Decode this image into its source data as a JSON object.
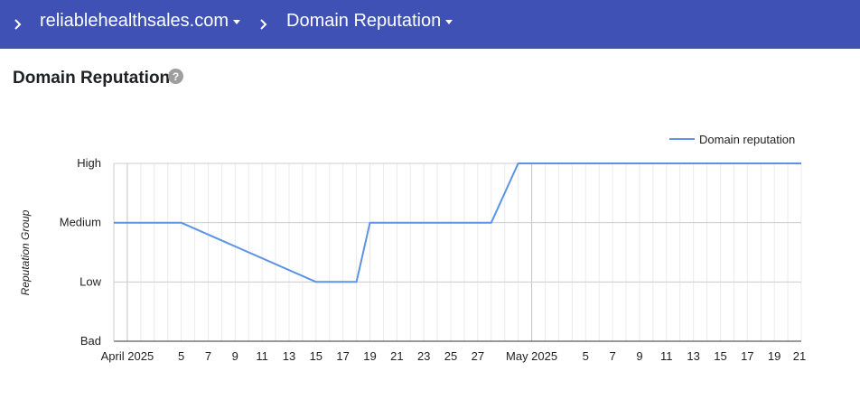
{
  "breadcrumb": {
    "domain": "reliablehealthsales.com",
    "section": "Domain Reputation"
  },
  "page": {
    "title": "Domain Reputation",
    "help_icon": "help-circle-icon"
  },
  "colors": {
    "topbar": "#3f51b5",
    "series": "#5c93e6",
    "grid": "#cccccc",
    "minor_grid": "#ebebeb"
  },
  "chart_data": {
    "type": "line",
    "ylabel": "Reputation Group",
    "xlabel": "",
    "y_categories": [
      "Bad",
      "Low",
      "Medium",
      "High"
    ],
    "x_range": [
      "2025-03-31",
      "2025-05-21"
    ],
    "x_ticks": [
      {
        "date": "2025-04-01",
        "label": "April 2025",
        "major": true
      },
      {
        "date": "2025-04-05",
        "label": "5"
      },
      {
        "date": "2025-04-07",
        "label": "7"
      },
      {
        "date": "2025-04-09",
        "label": "9"
      },
      {
        "date": "2025-04-11",
        "label": "11"
      },
      {
        "date": "2025-04-13",
        "label": "13"
      },
      {
        "date": "2025-04-15",
        "label": "15"
      },
      {
        "date": "2025-04-17",
        "label": "17"
      },
      {
        "date": "2025-04-19",
        "label": "19"
      },
      {
        "date": "2025-04-21",
        "label": "21"
      },
      {
        "date": "2025-04-23",
        "label": "23"
      },
      {
        "date": "2025-04-25",
        "label": "25"
      },
      {
        "date": "2025-04-27",
        "label": "27"
      },
      {
        "date": "2025-05-01",
        "label": "May 2025",
        "major": true
      },
      {
        "date": "2025-05-05",
        "label": "5"
      },
      {
        "date": "2025-05-07",
        "label": "7"
      },
      {
        "date": "2025-05-09",
        "label": "9"
      },
      {
        "date": "2025-05-11",
        "label": "11"
      },
      {
        "date": "2025-05-13",
        "label": "13"
      },
      {
        "date": "2025-05-15",
        "label": "15"
      },
      {
        "date": "2025-05-17",
        "label": "17"
      },
      {
        "date": "2025-05-19",
        "label": "19"
      },
      {
        "date": "2025-05-21",
        "label": "21"
      }
    ],
    "grid": true,
    "legend_position": "top-right",
    "series": [
      {
        "name": "Domain reputation",
        "points": [
          {
            "x": "2025-03-31",
            "y": "Medium"
          },
          {
            "x": "2025-04-05",
            "y": "Medium"
          },
          {
            "x": "2025-04-15",
            "y": "Low"
          },
          {
            "x": "2025-04-18",
            "y": "Low"
          },
          {
            "x": "2025-04-19",
            "y": "Medium"
          },
          {
            "x": "2025-04-28",
            "y": "Medium"
          },
          {
            "x": "2025-04-30",
            "y": "High"
          },
          {
            "x": "2025-05-21",
            "y": "High"
          }
        ]
      }
    ]
  }
}
